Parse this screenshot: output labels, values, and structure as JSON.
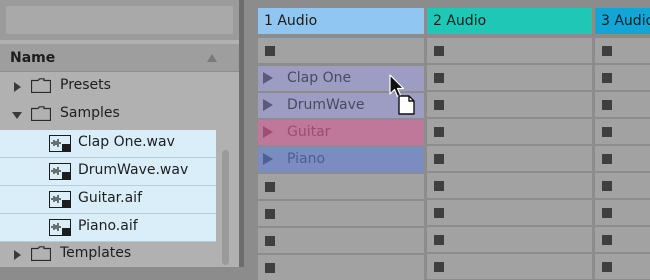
{
  "browser": {
    "column_header": "Name",
    "items": [
      {
        "label": "Presets",
        "type": "folder",
        "expanded": false
      },
      {
        "label": "Samples",
        "type": "folder",
        "expanded": true
      },
      {
        "label": "Clap One.wav",
        "type": "file"
      },
      {
        "label": "DrumWave.wav",
        "type": "file"
      },
      {
        "label": "Guitar.aif",
        "type": "file"
      },
      {
        "label": "Piano.aif",
        "type": "file"
      },
      {
        "label": "Templates",
        "type": "folder",
        "expanded": false
      }
    ]
  },
  "tracks": [
    {
      "name": "1 Audio",
      "color": "#8fc7f2"
    },
    {
      "name": "2 Audio",
      "color": "#1fc7b7"
    },
    {
      "name": "3 Audio",
      "color": "#12a6d6"
    }
  ],
  "clips": [
    {
      "name": "Clap One",
      "color": "#9d9dc4"
    },
    {
      "name": "DrumWave",
      "color": "#9d9dc4"
    },
    {
      "name": "Guitar",
      "color": "#c0789a"
    },
    {
      "name": "Piano",
      "color": "#7b8dc0"
    }
  ],
  "icons": {
    "folder": "folder-icon",
    "audio_file": "audio-file-icon",
    "cursor": "arrow-cursor-icon",
    "drag": "drag-file-icon"
  }
}
